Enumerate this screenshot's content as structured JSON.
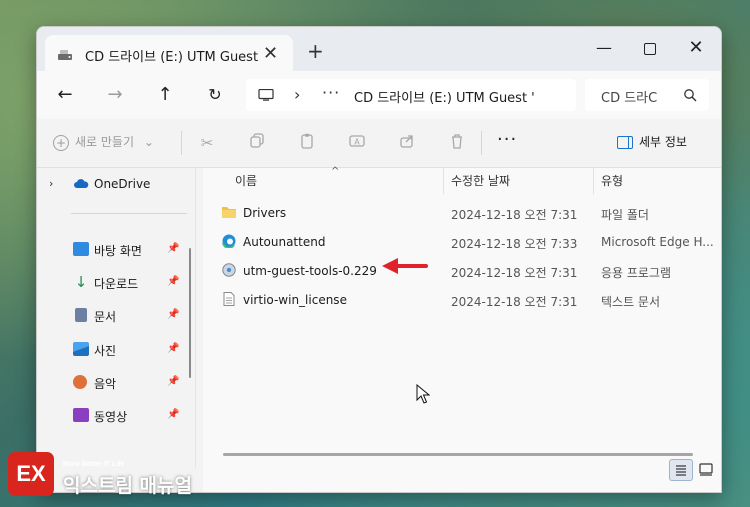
{
  "window": {
    "tab_title": "CD 드라이브 (E:) UTM Guest",
    "tab_close": "✕",
    "new_tab": "+",
    "min": "—",
    "close": "✕"
  },
  "nav": {
    "back": "←",
    "forward": "→",
    "up": "↑",
    "refresh": "↻",
    "address_sep": "›",
    "address_more": "···",
    "address_text": "CD 드라이브 (E:) UTM Guest '",
    "search_placeholder": "CD 드라C"
  },
  "toolbar": {
    "new_label": "새로 만들기",
    "new_caret": "⌄",
    "more": "···",
    "details_label": "세부 정보"
  },
  "sidebar": {
    "onedrive": {
      "chevron": "›",
      "label": "OneDrive"
    },
    "items": [
      {
        "label": "바탕 화면",
        "pin": "📌"
      },
      {
        "label": "다운로드",
        "pin": "📌"
      },
      {
        "label": "문서",
        "pin": "📌"
      },
      {
        "label": "사진",
        "pin": "📌"
      },
      {
        "label": "음악",
        "pin": "📌"
      },
      {
        "label": "동영상",
        "pin": "📌"
      }
    ]
  },
  "columns": {
    "name": "이름",
    "date": "수정한 날짜",
    "type": "유형",
    "sort_arrow": "^"
  },
  "files": [
    {
      "name": "Drivers",
      "date": "2024-12-18 오전 7:31",
      "type": "파일 폴더",
      "icon": "folder-icon"
    },
    {
      "name": "Autounattend",
      "date": "2024-12-18 오전 7:33",
      "type": "Microsoft Edge H...",
      "icon": "edge-icon"
    },
    {
      "name": "utm-guest-tools-0.229",
      "date": "2024-12-18 오전 7:31",
      "type": "응용 프로그램",
      "icon": "installer-icon"
    },
    {
      "name": "virtio-win_license",
      "date": "2024-12-18 오전 7:31",
      "type": "텍스트 문서",
      "icon": "text-file-icon"
    }
  ],
  "watermark": {
    "logo": "EX",
    "tagline": "More Better IT Life",
    "name": "익스트림 매뉴얼"
  },
  "colors": {
    "accent": "#1a73c7",
    "annotation_arrow": "#e0232b",
    "watermark_red": "#d8261f"
  }
}
